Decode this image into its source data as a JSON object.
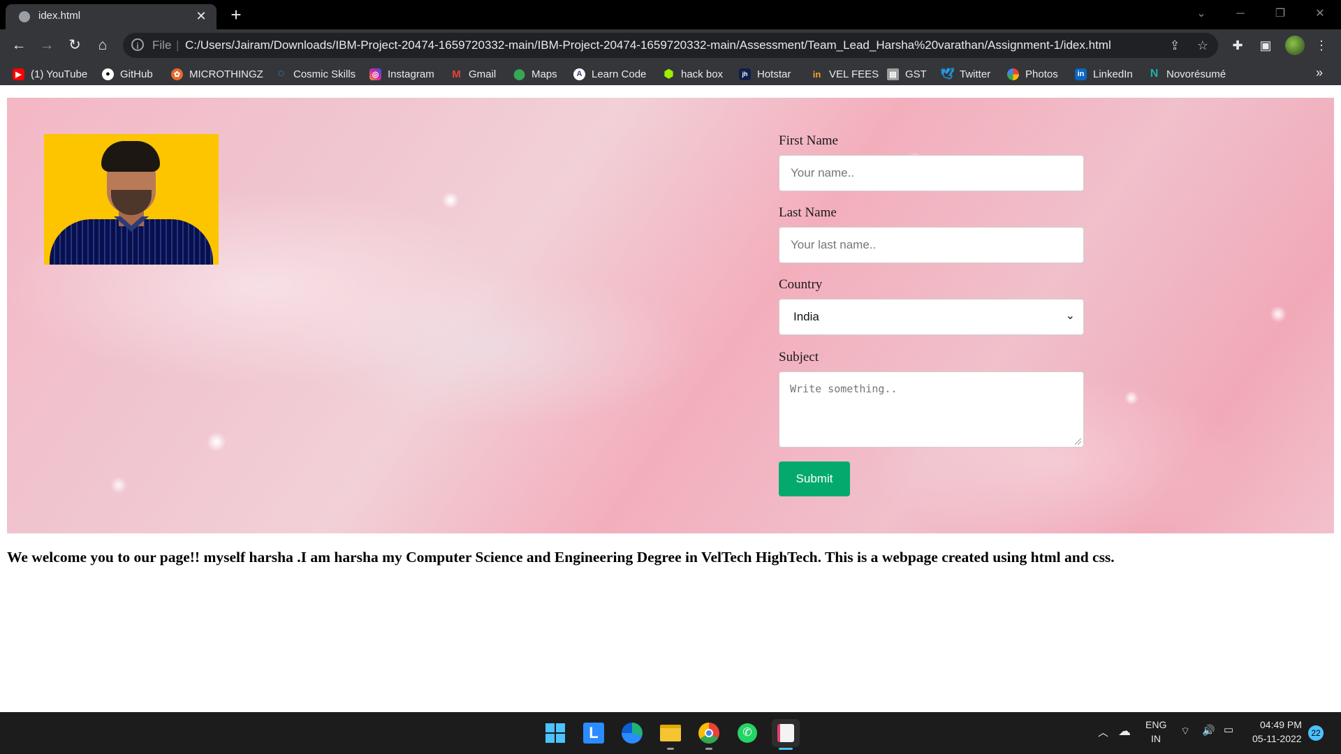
{
  "browser": {
    "tab": {
      "title": "idex.html"
    },
    "omnibox": {
      "scheme": "File",
      "url": "C:/Users/Jairam/Downloads/IBM-Project-20474-1659720332-main/IBM-Project-20474-1659720332-main/Assessment/Team_Lead_Harsha%20varathan/Assignment-1/idex.html"
    },
    "bookmarks": [
      {
        "label": "(1) YouTube",
        "icon": "youtube-icon",
        "color": "#ff0000"
      },
      {
        "label": "GitHub",
        "icon": "github-icon",
        "color": "#ffffff"
      },
      {
        "label": "MICROTHINGZ",
        "icon": "microthingz-icon",
        "color": "#e8672b"
      },
      {
        "label": "Cosmic Skills",
        "icon": "cosmic-skills-icon",
        "color": "#3fa9f5"
      },
      {
        "label": "Instagram",
        "icon": "instagram-icon",
        "color": "#d6249f"
      },
      {
        "label": "Gmail",
        "icon": "gmail-icon",
        "color": "#ea4335"
      },
      {
        "label": "Maps",
        "icon": "maps-icon",
        "color": "#34a853"
      },
      {
        "label": "Learn Code",
        "icon": "learn-code-icon",
        "color": "#3b3b6d"
      },
      {
        "label": "hack box",
        "icon": "hack-box-icon",
        "color": "#9fef00"
      },
      {
        "label": "Hotstar",
        "icon": "hotstar-icon",
        "color": "#0f1f4b"
      },
      {
        "label": "VEL FEES",
        "icon": "vel-fees-icon",
        "color": "#f5a623"
      },
      {
        "label": "GST",
        "icon": "gst-icon",
        "color": "#9e9e9e"
      },
      {
        "label": "Twitter",
        "icon": "twitter-icon",
        "color": "#1da1f2"
      },
      {
        "label": "Photos",
        "icon": "photos-icon",
        "color": "#fbbc04"
      },
      {
        "label": "LinkedIn",
        "icon": "linkedin-icon",
        "color": "#0a66c2"
      },
      {
        "label": "Novorésumé",
        "icon": "novoresume-icon",
        "color": "#19b3a6"
      }
    ]
  },
  "form": {
    "first_name": {
      "label": "First Name",
      "placeholder": "Your name.."
    },
    "last_name": {
      "label": "Last Name",
      "placeholder": "Your last name.."
    },
    "country": {
      "label": "Country",
      "value": "India"
    },
    "subject": {
      "label": "Subject",
      "placeholder": "Write something.."
    },
    "submit_label": "Submit",
    "submit_color": "#04aa6d"
  },
  "welcome_text": "We welcome you to our page!! myself harsha .I am harsha my Computer Science and Engineering Degree in VelTech HighTech. This is a webpage created using html and css.",
  "taskbar": {
    "lang_top": "ENG",
    "lang_bottom": "IN",
    "time": "04:49 PM",
    "date": "05-11-2022",
    "notifications": "22"
  }
}
